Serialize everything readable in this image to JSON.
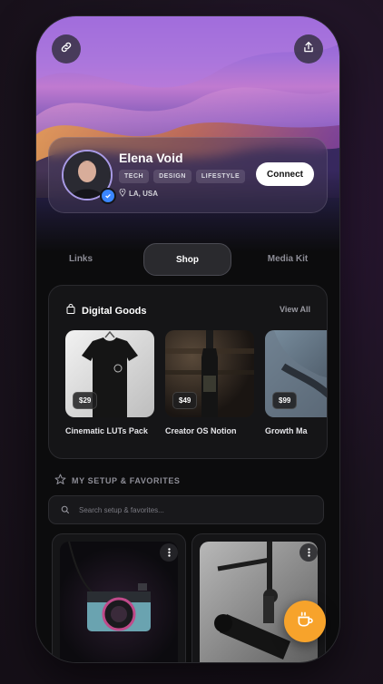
{
  "header": {
    "link_icon": "link-icon",
    "share_icon": "share-icon"
  },
  "profile": {
    "name": "Elena Void",
    "tags": [
      "TECH",
      "DESIGN",
      "LIFESTYLE"
    ],
    "location": "LA, USA",
    "connect_label": "Connect"
  },
  "tabs": [
    {
      "label": "Links",
      "active": false
    },
    {
      "label": "Shop",
      "active": true
    },
    {
      "label": "Media Kit",
      "active": false
    }
  ],
  "digital_goods": {
    "title": "Digital Goods",
    "view_all": "View All",
    "products": [
      {
        "name": "Cinematic LUTs Pack",
        "price": "$29"
      },
      {
        "name": "Creator OS Notion",
        "price": "$49"
      },
      {
        "name": "Growth Ma",
        "price": "$99"
      }
    ]
  },
  "setup": {
    "title": "MY SETUP & FAVORITES",
    "search_placeholder": "Search setup & favorites..."
  },
  "colors": {
    "accent": "#f7a32b",
    "verify": "#3a86ff"
  }
}
